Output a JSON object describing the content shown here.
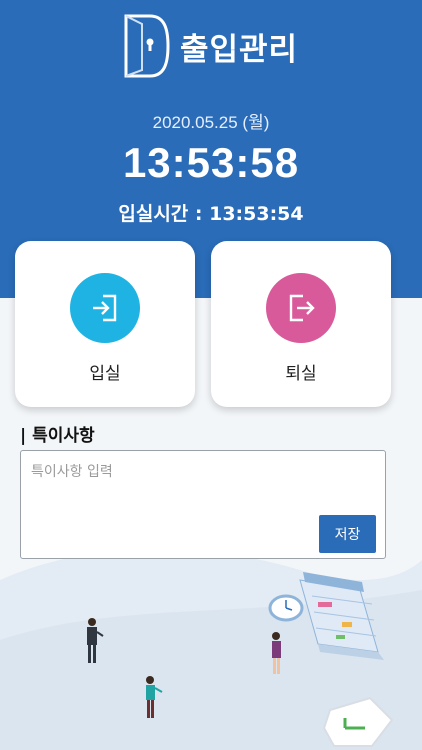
{
  "app": {
    "title": "출입관리"
  },
  "status": {
    "date": "2020.05.25 (월)",
    "current_time": "13:53:58",
    "entry_time_label": "입실시간 : 13:53:54"
  },
  "actions": {
    "check_in": {
      "label": "입실",
      "icon": "login-icon",
      "color": "#1fb3e3"
    },
    "check_out": {
      "label": "퇴실",
      "icon": "logout-icon",
      "color": "#d95a9a"
    }
  },
  "notes": {
    "title": "| 특이사항",
    "placeholder": "특이사항 입력",
    "value": "",
    "save_label": "저장"
  },
  "colors": {
    "primary": "#2a6cb8",
    "background": "#f3f6f9"
  }
}
